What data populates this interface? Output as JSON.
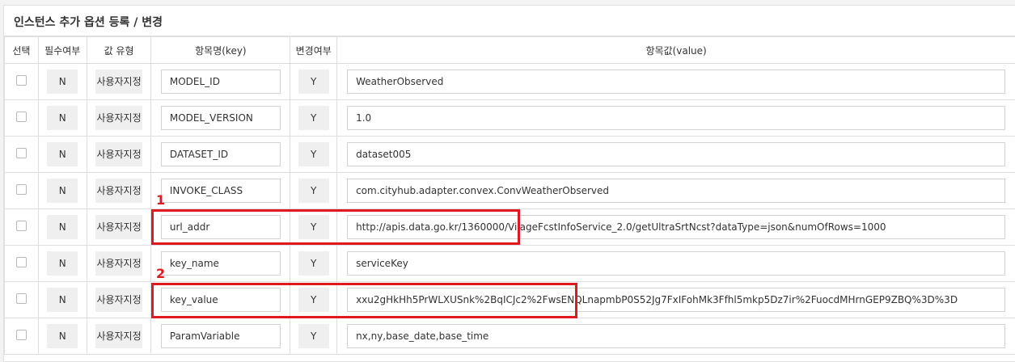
{
  "panel": {
    "title": "인스턴스 추가 옵션 등록 / 변경"
  },
  "columns": {
    "select": "선택",
    "required": "필수여부",
    "value_type": "값 유형",
    "key": "항목명(key)",
    "changed": "변경여부",
    "value": "항목값(value)"
  },
  "rows": [
    {
      "required": "N",
      "type": "사용자지정",
      "key": "MODEL_ID",
      "changed": "Y",
      "value": "WeatherObserved"
    },
    {
      "required": "N",
      "type": "사용자지정",
      "key": "MODEL_VERSION",
      "changed": "Y",
      "value": "1.0"
    },
    {
      "required": "N",
      "type": "사용자지정",
      "key": "DATASET_ID",
      "changed": "Y",
      "value": " dataset005"
    },
    {
      "required": "N",
      "type": "사용자지정",
      "key": "INVOKE_CLASS",
      "changed": "Y",
      "value": "com.cityhub.adapter.convex.ConvWeatherObserved"
    },
    {
      "required": "N",
      "type": "사용자지정",
      "key": "url_addr",
      "changed": "Y",
      "value": "http://apis.data.go.kr/1360000/VilageFcstInfoService_2.0/getUltraSrtNcst?dataType=json&numOfRows=1000"
    },
    {
      "required": "N",
      "type": "사용자지정",
      "key": "key_name",
      "changed": "Y",
      "value": "serviceKey"
    },
    {
      "required": "N",
      "type": "사용자지정",
      "key": "key_value",
      "changed": "Y",
      "value": "xxu2gHkHh5PrWLXUSnk%2BqICJc2%2FwsENQLnapmbP0S52Jg7FxIFohMk3Ffhl5mkp5Dz7ir%2FuocdMHrnGEP9ZBQ%3D%3D"
    },
    {
      "required": "N",
      "type": "사용자지정",
      "key": "ParamVariable",
      "changed": "Y",
      "value": "nx,ny,base_date,base_time"
    }
  ],
  "annotations": {
    "first": "1",
    "second": "2"
  },
  "colors": {
    "annotation": "#e0191e",
    "pill_bg": "#efefef",
    "border": "#dedede"
  }
}
